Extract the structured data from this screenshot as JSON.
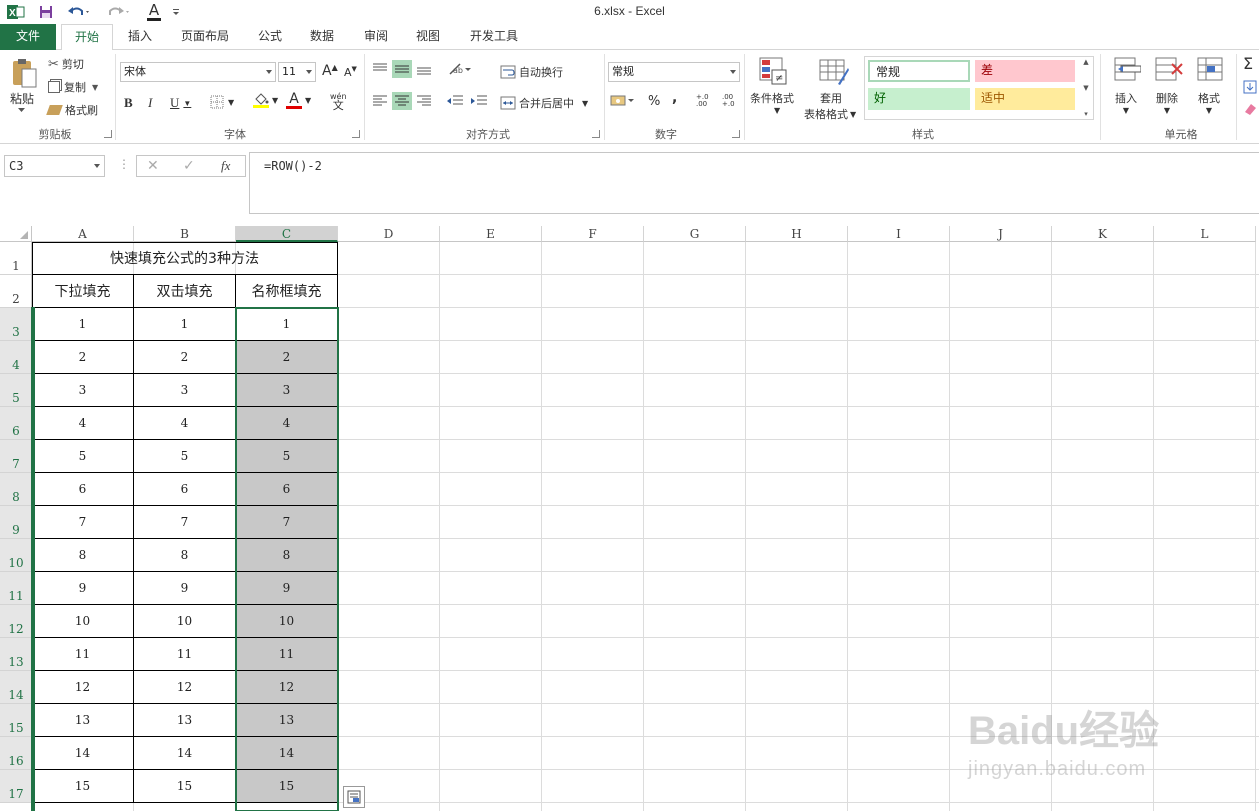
{
  "window": {
    "title": "6.xlsx - Excel"
  },
  "quick_access": {
    "font_color_letter": "A"
  },
  "tabs": [
    "文件",
    "开始",
    "插入",
    "页面布局",
    "公式",
    "数据",
    "审阅",
    "视图",
    "开发工具"
  ],
  "ribbon": {
    "clipboard": {
      "paste": "粘贴",
      "cut": "剪切",
      "copy": "复制",
      "format_painter": "格式刷",
      "label": "剪贴板"
    },
    "font": {
      "name": "宋体",
      "size": "11",
      "grow": "A",
      "shrink": "A",
      "bold": "B",
      "italic": "I",
      "underline": "U",
      "phonetic": "wén",
      "label": "字体"
    },
    "alignment": {
      "wrap_text": "自动换行",
      "merge_center": "合并后居中",
      "label": "对齐方式"
    },
    "number": {
      "format": "常规",
      "percent": "%",
      "comma": ",",
      "inc_decimal": "+.0 .00",
      "dec_decimal": ".00 +.0",
      "label": "数字"
    },
    "styles": {
      "conditional": "条件格式",
      "table_line1": "套用",
      "table_line2": "表格格式",
      "normal": "常规",
      "bad": "差",
      "good": "好",
      "neutral": "适中",
      "label": "样式"
    },
    "cells": {
      "insert": "插入",
      "delete": "删除",
      "format": "格式",
      "label": "单元格"
    }
  },
  "formula_bar": {
    "name_box": "C3",
    "fx": "fx",
    "formula": "=ROW()-2"
  },
  "colors": {
    "accent": "#217346",
    "shade": "#c8c8c8",
    "bad_bg": "#ffc7ce",
    "bad_fg": "#9c0006",
    "good_bg": "#c6efce",
    "good_fg": "#006100",
    "neutral_bg": "#ffeb9c",
    "neutral_fg": "#9c5700"
  },
  "sheet": {
    "columns": [
      "A",
      "B",
      "C",
      "D",
      "E",
      "F",
      "G",
      "H",
      "I",
      "J",
      "K",
      "L"
    ],
    "rows": [
      "1",
      "2",
      "3",
      "4",
      "5",
      "6",
      "7",
      "8",
      "9",
      "10",
      "11",
      "12",
      "13",
      "14",
      "15",
      "16",
      "17"
    ],
    "title": "快速填充公式的3种方法",
    "headers": [
      "下拉填充",
      "双击填充",
      "名称框填充"
    ],
    "data": [
      [
        "1",
        "1",
        "1"
      ],
      [
        "2",
        "2",
        "2"
      ],
      [
        "3",
        "3",
        "3"
      ],
      [
        "4",
        "4",
        "4"
      ],
      [
        "5",
        "5",
        "5"
      ],
      [
        "6",
        "6",
        "6"
      ],
      [
        "7",
        "7",
        "7"
      ],
      [
        "8",
        "8",
        "8"
      ],
      [
        "9",
        "9",
        "9"
      ],
      [
        "10",
        "10",
        "10"
      ],
      [
        "11",
        "11",
        "11"
      ],
      [
        "12",
        "12",
        "12"
      ],
      [
        "13",
        "13",
        "13"
      ],
      [
        "14",
        "14",
        "14"
      ],
      [
        "15",
        "15",
        "15"
      ]
    ]
  },
  "watermark": {
    "brand": "Baidu经验",
    "url": "jingyan.baidu.com"
  }
}
